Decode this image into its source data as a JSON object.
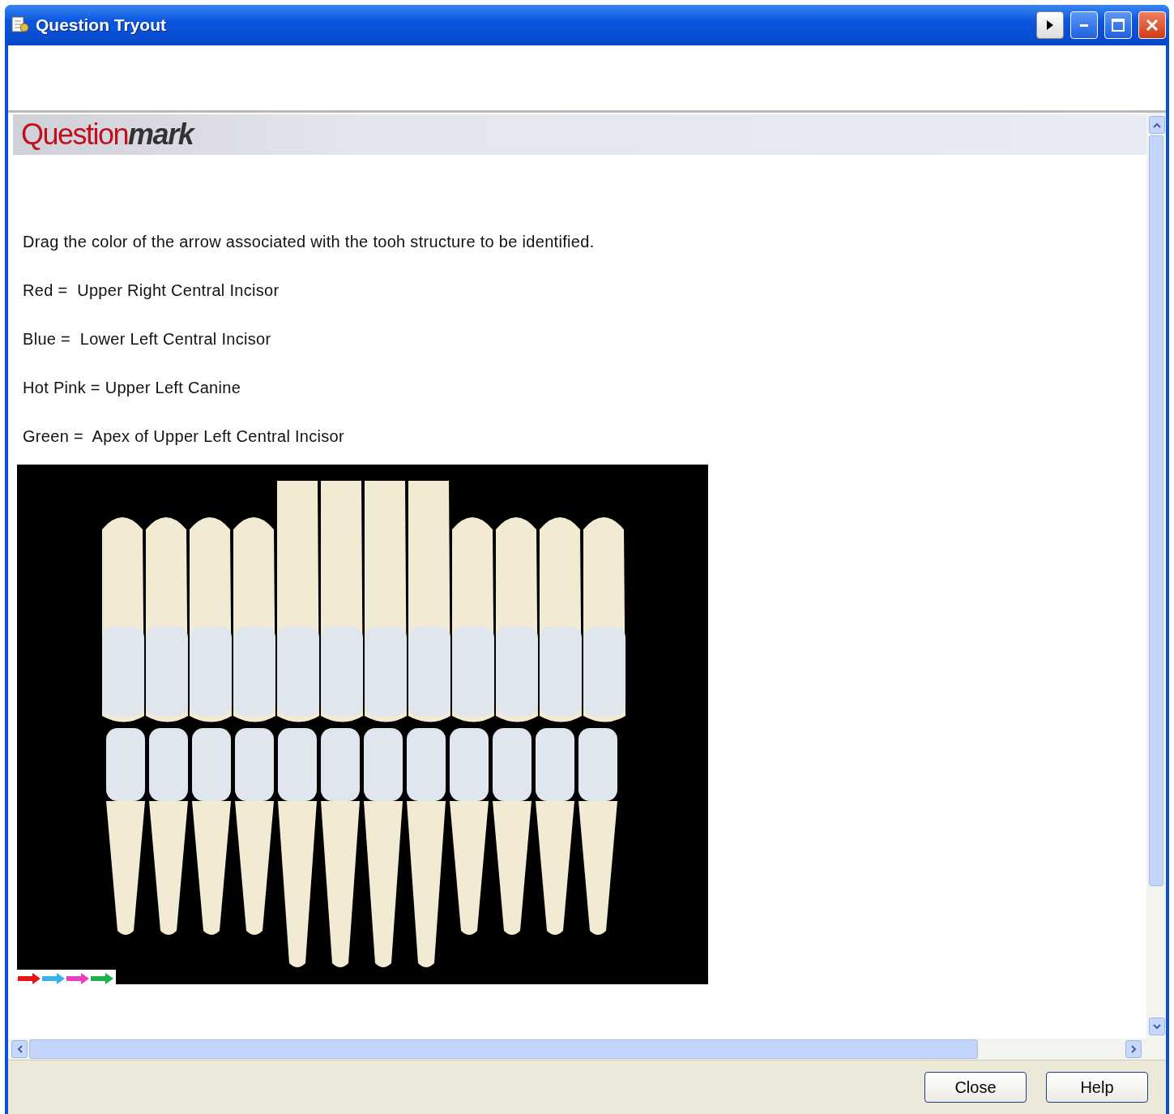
{
  "window": {
    "title": "Question Tryout"
  },
  "header": {
    "logo_light": "Question",
    "logo_bold": "mark"
  },
  "question": {
    "instruction": "Drag the color of the arrow associated with the tooh structure to be identified.",
    "legend": [
      "Red =  Upper Right Central Incisor",
      "Blue =  Lower Left Central Incisor",
      "Hot Pink = Upper Left Canine",
      "Green =  Apex of Upper Left Central Incisor"
    ],
    "arrows": [
      {
        "color": "#e8141c"
      },
      {
        "color": "#34b4e8"
      },
      {
        "color": "#e840c0"
      },
      {
        "color": "#20b050"
      }
    ]
  },
  "buttons": [
    "Close",
    "Help"
  ]
}
